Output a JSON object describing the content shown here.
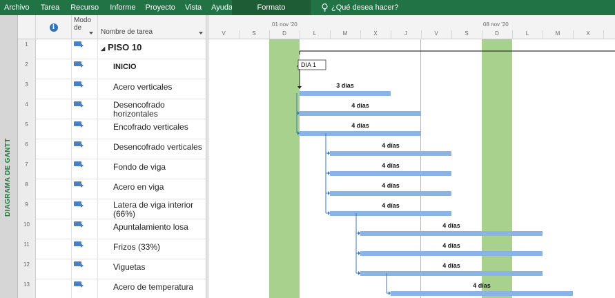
{
  "ribbon": {
    "tabs": [
      "Archivo",
      "Tarea",
      "Recurso",
      "Informe",
      "Proyecto",
      "Vista",
      "Ayuda"
    ],
    "format_label": "Formato",
    "tell_me": "¿Qué desea hacer?"
  },
  "side_label": "DIAGRAMA DE GANTT",
  "table": {
    "header": {
      "mode": "Modo de",
      "name": "Nombre de tarea"
    },
    "rows": [
      {
        "id": "1",
        "name": "PISO 10",
        "summary": true
      },
      {
        "id": "2",
        "name": "INICIO",
        "bold": true
      },
      {
        "id": "3",
        "name": "Acero verticales"
      },
      {
        "id": "4",
        "name": "Desencofrado horizontales"
      },
      {
        "id": "5",
        "name": "Encofrado verticales"
      },
      {
        "id": "6",
        "name": "Desencofrado verticales"
      },
      {
        "id": "7",
        "name": "Fondo de viga"
      },
      {
        "id": "8",
        "name": "Acero en viga"
      },
      {
        "id": "9",
        "name": "Latera de viga interior (66%)"
      },
      {
        "id": "10",
        "name": "Apuntalamiento losa"
      },
      {
        "id": "11",
        "name": "Frizos (33%)"
      },
      {
        "id": "12",
        "name": "Viguetas"
      },
      {
        "id": "13",
        "name": "Acero de temperatura"
      }
    ]
  },
  "timescale": {
    "weeks": [
      "01 nov '20",
      "08 nov '20"
    ],
    "days": [
      "V",
      "S",
      "D",
      "L",
      "M",
      "X",
      "J",
      "V",
      "S",
      "D",
      "L",
      "M",
      "X"
    ]
  },
  "gantt": {
    "milestone_label": "DIA 1",
    "tasks": [
      {
        "row": 2,
        "start": 3,
        "days": 3,
        "label": "3 días"
      },
      {
        "row": 3,
        "start": 3,
        "days": 4,
        "label": "4 días"
      },
      {
        "row": 4,
        "start": 3,
        "days": 4,
        "label": "4 días"
      },
      {
        "row": 5,
        "start": 4,
        "days": 4,
        "label": "4 días"
      },
      {
        "row": 6,
        "start": 4,
        "days": 4,
        "label": "4 días"
      },
      {
        "row": 7,
        "start": 4,
        "days": 4,
        "label": "4 días"
      },
      {
        "row": 8,
        "start": 4,
        "days": 4,
        "label": "4 días"
      },
      {
        "row": 9,
        "start": 5,
        "days": 6,
        "label": "4 días"
      },
      {
        "row": 10,
        "start": 5,
        "days": 6,
        "label": "4 días"
      },
      {
        "row": 11,
        "start": 5,
        "days": 6,
        "label": "4 días"
      },
      {
        "row": 12,
        "start": 6,
        "days": 6,
        "label": "4 días"
      }
    ],
    "colors": {
      "bar": "#8ab4e6",
      "nonworking": "#a9d18e",
      "link": "#3b78c2",
      "today": "#9fd27e"
    }
  }
}
